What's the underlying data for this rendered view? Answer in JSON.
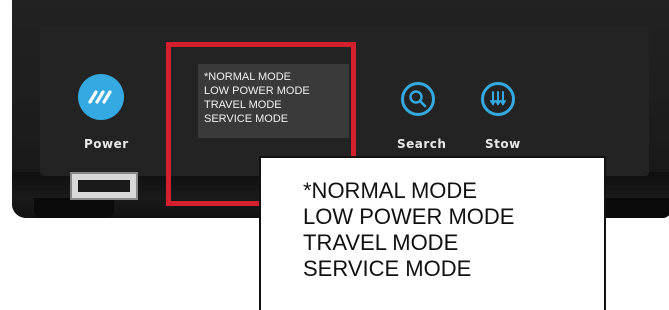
{
  "buttons": {
    "power_label": "Power",
    "search_label": "Search",
    "stow_label": "Stow"
  },
  "display": {
    "modes": [
      "*NORMAL MODE",
      "LOW POWER MODE",
      "TRAVEL MODE",
      "SERVICE MODE"
    ]
  },
  "callout": {
    "modes": [
      "*NORMAL MODE",
      "LOW POWER MODE",
      "TRAVEL MODE",
      "SERVICE MODE"
    ]
  },
  "colors": {
    "accent_blue": "#35a9e1",
    "highlight_red": "#d3202c",
    "device_body": "#1c1c1c"
  },
  "icons": {
    "power": "power-logo-icon",
    "search": "magnifier-icon",
    "stow": "stow-arrows-icon",
    "usb": "usb-port-icon"
  }
}
